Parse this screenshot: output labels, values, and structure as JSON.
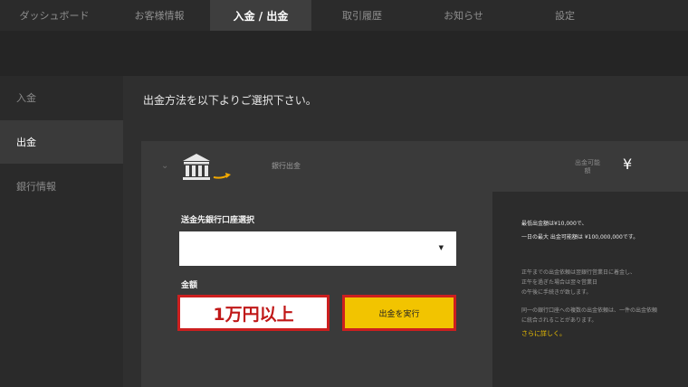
{
  "nav": {
    "tabs": [
      {
        "label": "ダッシュボード"
      },
      {
        "label": "お客様情報"
      },
      {
        "label": "入金 / 出金"
      },
      {
        "label": "取引履歴"
      },
      {
        "label": "お知らせ"
      },
      {
        "label": "設定"
      }
    ],
    "active_index": 2
  },
  "sidebar": {
    "items": [
      {
        "label": "入金"
      },
      {
        "label": "出金"
      },
      {
        "label": "銀行情報"
      }
    ],
    "active_index": 1
  },
  "main": {
    "title": "出金方法を以下よりご選択下さい。",
    "method": {
      "name": "銀行出金",
      "available_label": "出金可能額",
      "currency_symbol": "¥"
    },
    "form": {
      "destination_label": "送金先銀行口座選択",
      "destination_value": "",
      "amount_label": "金額",
      "amount_hint": "1万円以上",
      "submit_label": "出金を実行"
    },
    "info": {
      "min_line": "最低出金額は¥10,000で、",
      "max_line": "一日の最大 出金可能額は ¥100,000,000です。",
      "note1": "正午までの出金依頼は翌銀行営業日に着金し、",
      "note2": "正午を過ぎた場合は翌々営業日",
      "note3": "の午後に手続きが致します。",
      "note4": "同一の銀行口座への複数の出金依頼は、一件の出金依頼",
      "note5": "に統合されることがあります。",
      "link": "さらに詳しく。"
    }
  },
  "colors": {
    "accent": "#f2c400",
    "highlight_border": "#cc1f1f",
    "amount_text": "#c01818"
  }
}
